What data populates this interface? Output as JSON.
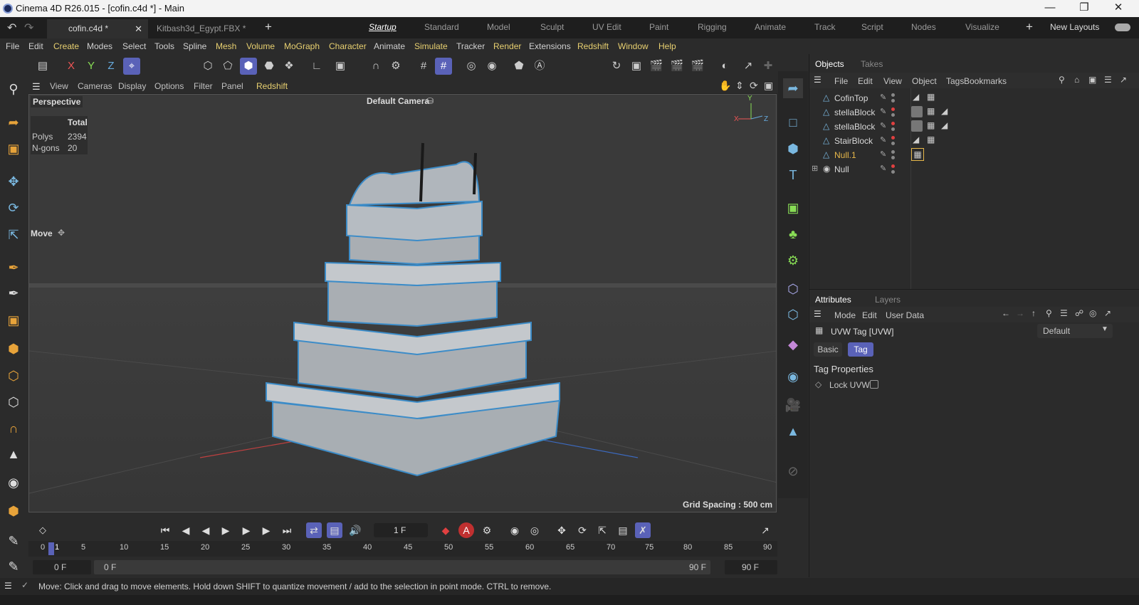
{
  "window": {
    "title": "Cinema 4D R26.015 - [cofin.c4d *] - Main"
  },
  "doc_tabs": [
    {
      "label": "cofin.c4d *"
    },
    {
      "label": "Kitbash3d_Egypt.FBX *"
    }
  ],
  "layouts": [
    "Startup",
    "Standard",
    "Model",
    "Sculpt",
    "UV Edit",
    "Paint",
    "Rigging",
    "Animate",
    "Track",
    "Script",
    "Nodes",
    "Visualize"
  ],
  "new_layouts_label": "New Layouts",
  "menu": [
    "File",
    "Edit",
    "Create",
    "Modes",
    "Select",
    "Tools",
    "Spline",
    "Mesh",
    "Volume",
    "MoGraph",
    "Character",
    "Animate",
    "Simulate",
    "Tracker",
    "Render",
    "Extensions",
    "Redshift",
    "Window",
    "Help"
  ],
  "axis_buttons": [
    "X",
    "Y",
    "Z"
  ],
  "viewport_menu": [
    "View",
    "Cameras",
    "Display",
    "Options",
    "Filter",
    "Panel",
    "Redshift"
  ],
  "viewport": {
    "mode": "Perspective",
    "camera": "Default Camera",
    "stats_header": "Total",
    "stats": [
      {
        "label": "Polys",
        "value": "2394"
      },
      {
        "label": "N-gons",
        "value": "20"
      }
    ],
    "tool_label": "Move",
    "grid_spacing": "Grid Spacing : 500 cm",
    "axis_x": "X",
    "axis_y": "Y",
    "axis_z": "Z"
  },
  "objects_panel": {
    "tabs": [
      "Objects",
      "Takes"
    ],
    "menu": [
      "File",
      "Edit",
      "View",
      "Object",
      "Tags",
      "Bookmarks"
    ],
    "items": [
      {
        "name": "CofinTop",
        "color": "#d8d8d8"
      },
      {
        "name": "stellaBlock",
        "color": "#d8d8d8"
      },
      {
        "name": "stellaBlock",
        "color": "#d8d8d8"
      },
      {
        "name": "StairBlock",
        "color": "#d8d8d8"
      },
      {
        "name": "Null.1",
        "color": "#e8b84a"
      },
      {
        "name": "Null",
        "color": "#d8d8d8"
      }
    ]
  },
  "attributes_panel": {
    "tabs": [
      "Attributes",
      "Layers"
    ],
    "menu": [
      "Mode",
      "Edit",
      "User Data"
    ],
    "tag_title": "UVW Tag [UVW]",
    "preset": "Default",
    "subtabs": [
      "Basic",
      "Tag"
    ],
    "section": "Tag Properties",
    "field_label": "Lock UVW"
  },
  "timeline": {
    "current_frame": "1 F",
    "ticks": [
      "0",
      "5",
      "10",
      "15",
      "20",
      "25",
      "30",
      "35",
      "40",
      "45",
      "50",
      "55",
      "60",
      "65",
      "70",
      "75",
      "80",
      "85",
      "90"
    ],
    "start_field": "0 F",
    "range_start": "0 F",
    "range_end": "90 F",
    "end_field": "90 F",
    "playhead_label": "1"
  },
  "status": {
    "message": "Move: Click and drag to move elements. Hold down SHIFT to quantize movement / add to the selection in point mode. CTRL to remove."
  }
}
